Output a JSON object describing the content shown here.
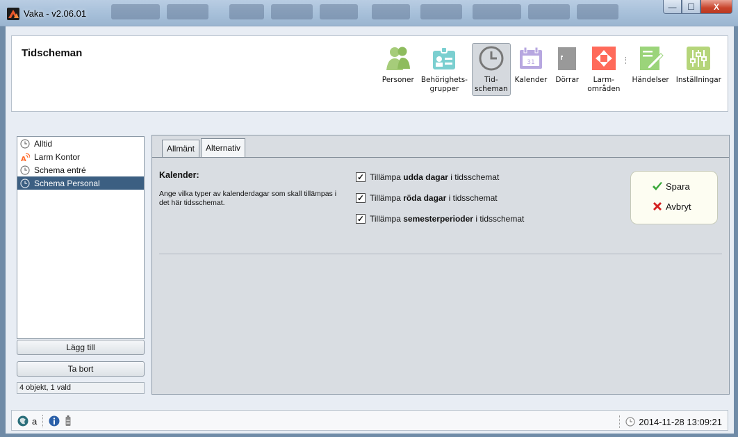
{
  "window": {
    "title": "Vaka - v2.06.01",
    "min": "—",
    "max": "☐",
    "close": "X"
  },
  "header": {
    "title": "Tidscheman"
  },
  "toolbar": [
    {
      "id": "personer",
      "label": "Personer",
      "icon": "people-icon"
    },
    {
      "id": "behorighetsgrupper",
      "label": "Behörighets-\ngrupper",
      "icon": "badge-icon"
    },
    {
      "id": "tidscheman",
      "label": "Tid-\nscheman",
      "icon": "clock-icon",
      "active": true
    },
    {
      "id": "kalender",
      "label": "Kalender",
      "icon": "calendar-icon"
    },
    {
      "id": "dorrar",
      "label": "Dörrar",
      "icon": "door-icon"
    },
    {
      "id": "larmomraden",
      "label": "Larm-\nområden",
      "icon": "alarm-areas-icon"
    },
    {
      "id": "handelser",
      "label": "Händelser",
      "icon": "edit-log-icon"
    },
    {
      "id": "installningar",
      "label": "Inställningar",
      "icon": "sliders-icon"
    }
  ],
  "list": {
    "items": [
      {
        "label": "Alltid",
        "icon": "clock-icon"
      },
      {
        "label": "Larm Kontor",
        "icon": "alarm-icon"
      },
      {
        "label": "Schema entré",
        "icon": "clock-icon"
      },
      {
        "label": "Schema Personal",
        "icon": "clock-icon",
        "selected": true
      }
    ],
    "add_label": "Lägg till",
    "remove_label": "Ta bort",
    "count_text": "4 objekt, 1 vald"
  },
  "tabs": [
    {
      "label": "Allmänt"
    },
    {
      "label": "Alternativ",
      "active": true
    }
  ],
  "calendar_section": {
    "title": "Kalender:",
    "description": "Ange vilka typer av kalenderdagar som skall tillämpas i det här tidsschemat.",
    "options": [
      {
        "prefix": "Tillämpa",
        "bold": "udda dagar",
        "suffix": "i tidsschemat",
        "checked": true
      },
      {
        "prefix": "Tillämpa",
        "bold": "röda dagar",
        "suffix": "i tidsschemat",
        "checked": true
      },
      {
        "prefix": "Tillämpa",
        "bold": "semesterperioder",
        "suffix": "i tidsschemat",
        "checked": true
      }
    ]
  },
  "actions": {
    "save_label": "Spara",
    "cancel_label": "Avbryt"
  },
  "status": {
    "user": "a",
    "datetime": "2014-11-28 13:09:21"
  },
  "colors": {
    "selection": "#3c5f82",
    "save": "#3aa83a",
    "cancel": "#d42020",
    "toolbar_icon": "#9dc76a",
    "toolbar_icon_alt": "#b7a7e0",
    "alarm": "#ff6a5a"
  }
}
